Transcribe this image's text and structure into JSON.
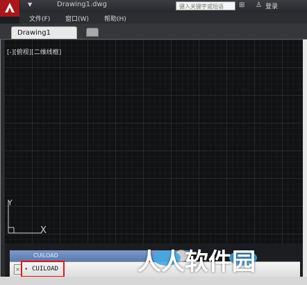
{
  "app": {
    "doc_title": "Drawing1.dwg",
    "search_placeholder": "键入关键字或短语",
    "login_label": "登录"
  },
  "menu": {
    "items": [
      "文件(F)",
      "窗口(W)",
      "帮助(H)"
    ]
  },
  "tabs": {
    "active_label": "Drawing1"
  },
  "viewport": {
    "label": "[-][俯视][二维线框]",
    "ucs_y": "Y",
    "ucs_x": "X"
  },
  "command": {
    "history_text": "CUILOAD",
    "input_value": "CUILOAD",
    "close_glyph": "×",
    "arrow_glyph": "▾"
  },
  "watermark": {
    "text": "人人软件园"
  },
  "colors": {
    "accent_red": "#a8171b",
    "highlight": "#e01515",
    "history_bar": "#6a88bc"
  }
}
